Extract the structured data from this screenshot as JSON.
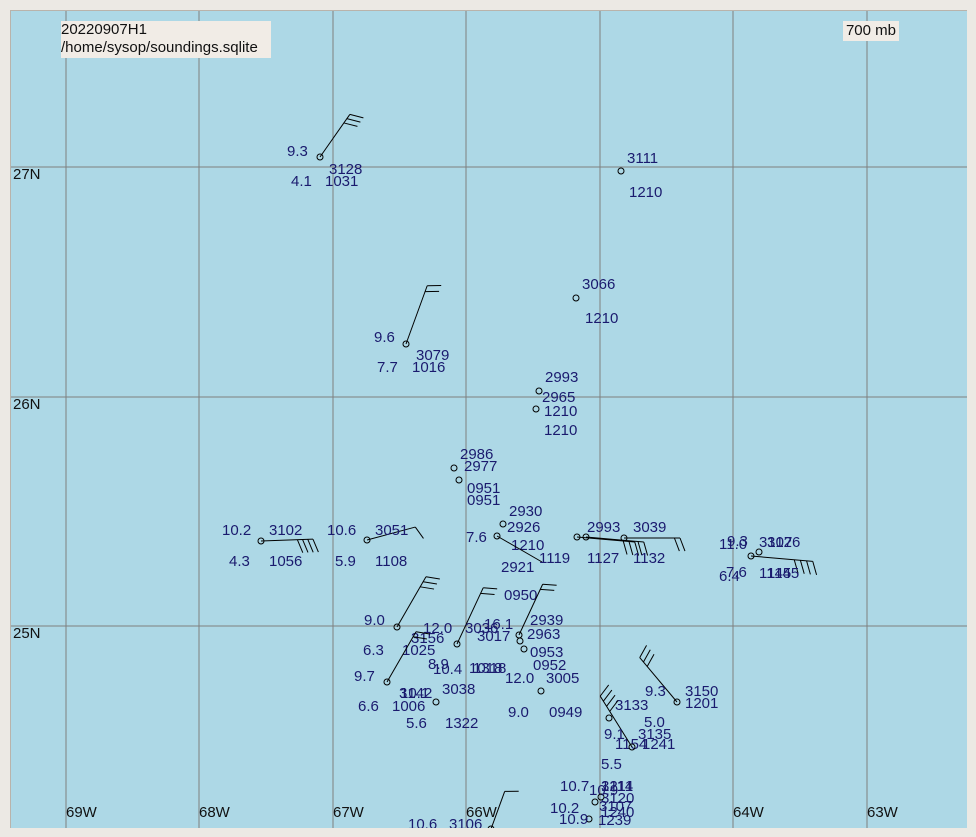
{
  "header": {
    "run_id": "20220907H1",
    "db_path": "/home/sysop/soundings.sqlite",
    "level": "700 mb"
  },
  "axes": {
    "lat_labels": [
      "27N",
      "26N",
      "25N"
    ],
    "lon_labels": [
      "69W",
      "68W",
      "67W",
      "66W",
      "64W",
      "63W"
    ]
  },
  "colors": {
    "ocean": "#add8e6",
    "grid": "#7f7f7f",
    "text": "#1a1a6e",
    "symbol": "#000000"
  },
  "stations": [
    {
      "temp": "9.3",
      "dew": "4.1",
      "hgt": "3128",
      "time": "1031"
    },
    {
      "temp": "",
      "dew": "",
      "hgt": "3111",
      "time": "1210"
    },
    {
      "temp": "",
      "dew": "",
      "hgt": "3066",
      "time": "1210"
    },
    {
      "temp": "9.6",
      "dew": "7.7",
      "hgt": "3079",
      "time": "1016"
    },
    {
      "temp": "",
      "dew": "",
      "hgt": "2993",
      "time": "1210"
    },
    {
      "temp": "",
      "dew": "",
      "hgt": "2965",
      "time": "1210"
    },
    {
      "temp": "",
      "dew": "",
      "hgt": "2986",
      "time": "0951"
    },
    {
      "temp": "",
      "dew": "",
      "hgt": "2977",
      "time": "0951"
    },
    {
      "temp": "10.2",
      "dew": "4.3",
      "hgt": "3102",
      "time": "1056"
    },
    {
      "temp": "10.6",
      "dew": "5.9",
      "hgt": "3051",
      "time": "1108"
    },
    {
      "temp": "",
      "dew": "",
      "hgt": "2930",
      "time": "1210"
    },
    {
      "temp": "7.6",
      "dew": "",
      "hgt": "2921",
      "time": "0950"
    },
    {
      "temp": "",
      "dew": "",
      "hgt": "2926",
      "time": "1119"
    },
    {
      "temp": "",
      "dew": "",
      "hgt": "2993",
      "time": "1127"
    },
    {
      "temp": "",
      "dew": "",
      "hgt": "3039",
      "time": "1132"
    },
    {
      "temp": "11.0",
      "dew": "6.4",
      "hgt": "3107",
      "time": "1145"
    },
    {
      "temp": "9.3",
      "dew": "7.6",
      "hgt": "3126",
      "time": "1145"
    },
    {
      "temp": "9.0",
      "dew": "6.3",
      "hgt": "3156",
      "time": "1025"
    },
    {
      "temp": "12.0",
      "dew": "8.9",
      "hgt": "3036",
      "time": "1018"
    },
    {
      "temp": "16.1",
      "dew": "10.4",
      "hgt": "3017",
      "time": "1318"
    },
    {
      "temp": "",
      "dew": "",
      "hgt": "2939",
      "time": "0953"
    },
    {
      "temp": "",
      "dew": "",
      "hgt": "2963",
      "time": "0952"
    },
    {
      "temp": "9.7",
      "dew": "6.6",
      "hgt": "3142",
      "time": "1006"
    },
    {
      "temp": "10.1",
      "dew": "5.6",
      "hgt": "3038",
      "time": "1322"
    },
    {
      "temp": "12.0",
      "dew": "9.0",
      "hgt": "3005",
      "time": "0949"
    },
    {
      "temp": "9.3",
      "dew": "5.0",
      "hgt": "3150",
      "time": "1201"
    },
    {
      "temp": "",
      "dew": "",
      "hgt": "3133",
      "time": "1154"
    },
    {
      "temp": "9.1",
      "dew": "",
      "hgt": "3135",
      "time": "1241"
    },
    {
      "temp": "5.5",
      "dew": "10.9",
      "hgt": "3114",
      "time": "1211"
    },
    {
      "temp": "10.7",
      "dew": "",
      "hgt": "3120",
      "time": "1240"
    },
    {
      "temp": "10.2",
      "dew": "10.9",
      "hgt": "3107",
      "time": "1239"
    },
    {
      "temp": "10.6",
      "dew": "",
      "hgt": "3106",
      "time": ""
    }
  ]
}
